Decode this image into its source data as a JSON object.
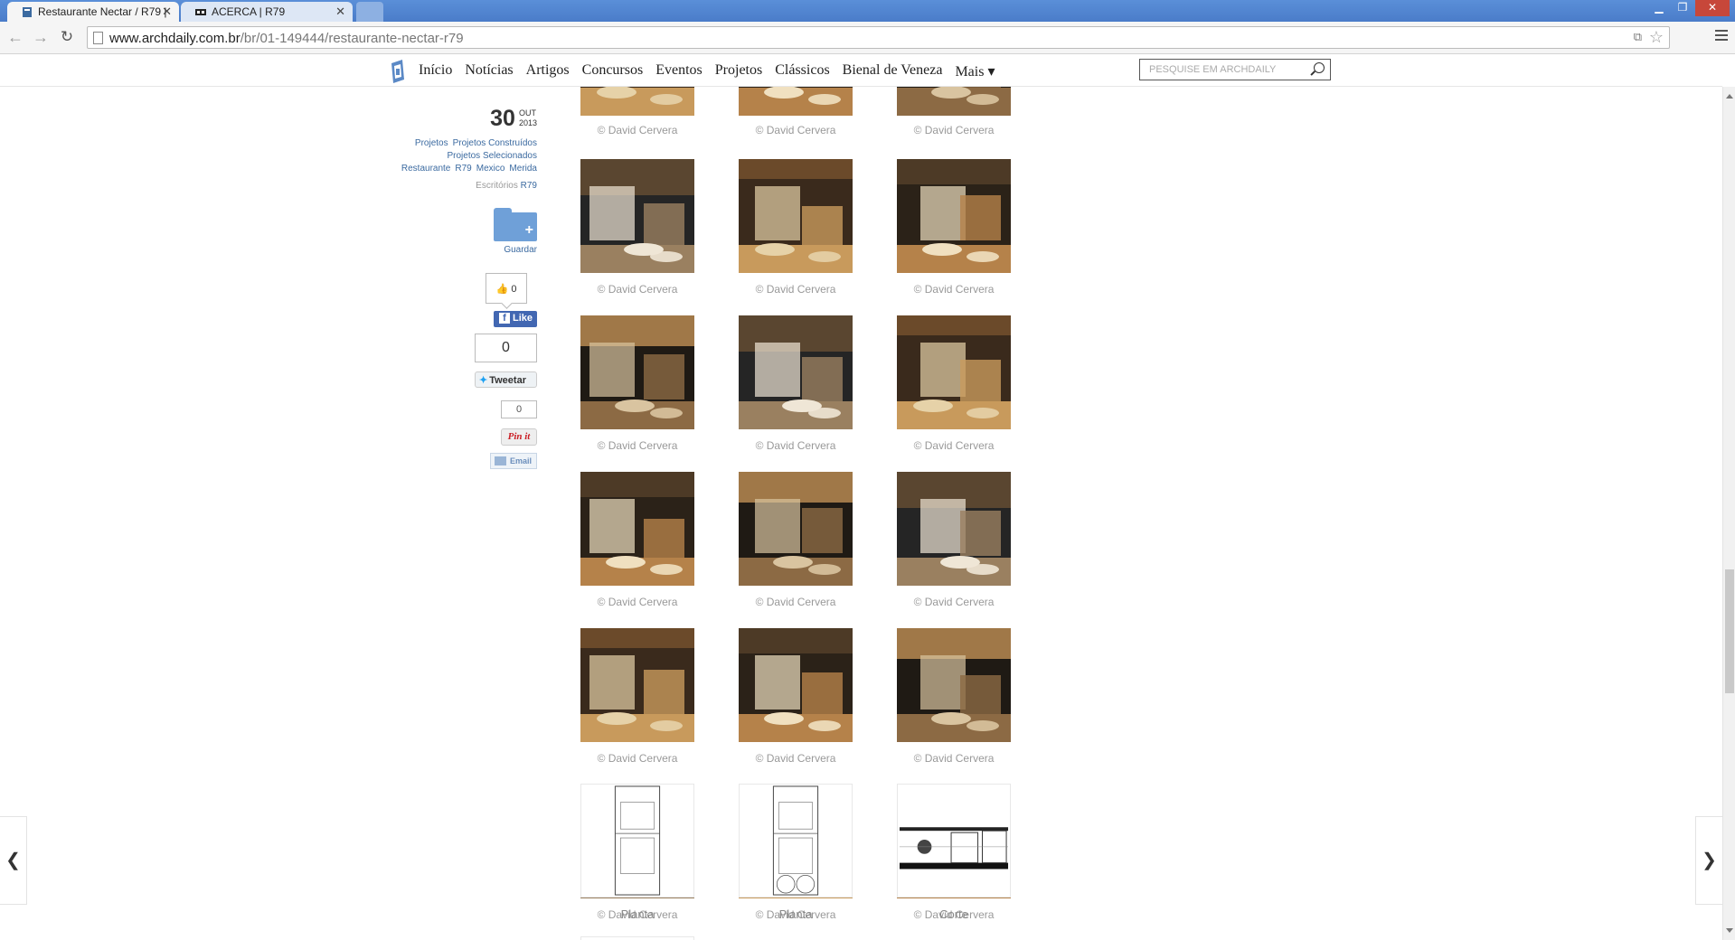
{
  "browser": {
    "tabs": [
      {
        "title": "Restaurante Nectar / R79 |",
        "active": true
      },
      {
        "title": "ACERCA | R79",
        "active": false
      }
    ],
    "url_host": "www.archdaily.com.br",
    "url_path": "/br/01-149444/restaurante-nectar-r79"
  },
  "nav": {
    "links": [
      "Início",
      "Notícias",
      "Artigos",
      "Concursos",
      "Eventos",
      "Projetos",
      "Clássicos",
      "Bienal de Veneza",
      "Mais ▾"
    ],
    "search_placeholder": "PESQUISE EM ARCHDAILY"
  },
  "sidebar": {
    "day": "30",
    "month": "OUT",
    "year": "2013",
    "tags_line1": [
      "Projetos",
      "Projetos Construídos"
    ],
    "tags_line2": [
      "Projetos Selecionados"
    ],
    "tags_line3": [
      "Restaurante",
      "R79",
      "Mexico",
      "Merida"
    ],
    "offices_label": "Escritórios",
    "offices_link": "R79",
    "save_label": "Guardar",
    "like_count": "0",
    "fb_like_label": "Like",
    "tweet_count": "0",
    "tweet_label": "Tweetar",
    "pin_count": "0",
    "pin_label": "Pin it",
    "email_label": "Email"
  },
  "gallery": {
    "rows": [
      [
        "© David Cervera",
        "© David Cervera",
        "© David Cervera"
      ],
      [
        "© David Cervera",
        "© David Cervera",
        "© David Cervera"
      ],
      [
        "© David Cervera",
        "© David Cervera",
        "© David Cervera"
      ],
      [
        "© David Cervera",
        "© David Cervera",
        "© David Cervera"
      ],
      [
        "© David Cervera",
        "© David Cervera",
        "© David Cervera"
      ],
      [
        "© David Cervera",
        "© David Cervera",
        "© David Cervera"
      ]
    ],
    "drawings": [
      "Planta",
      "Planta",
      "Corte"
    ]
  },
  "arrows": {
    "prev": "❮",
    "next": "❯"
  }
}
